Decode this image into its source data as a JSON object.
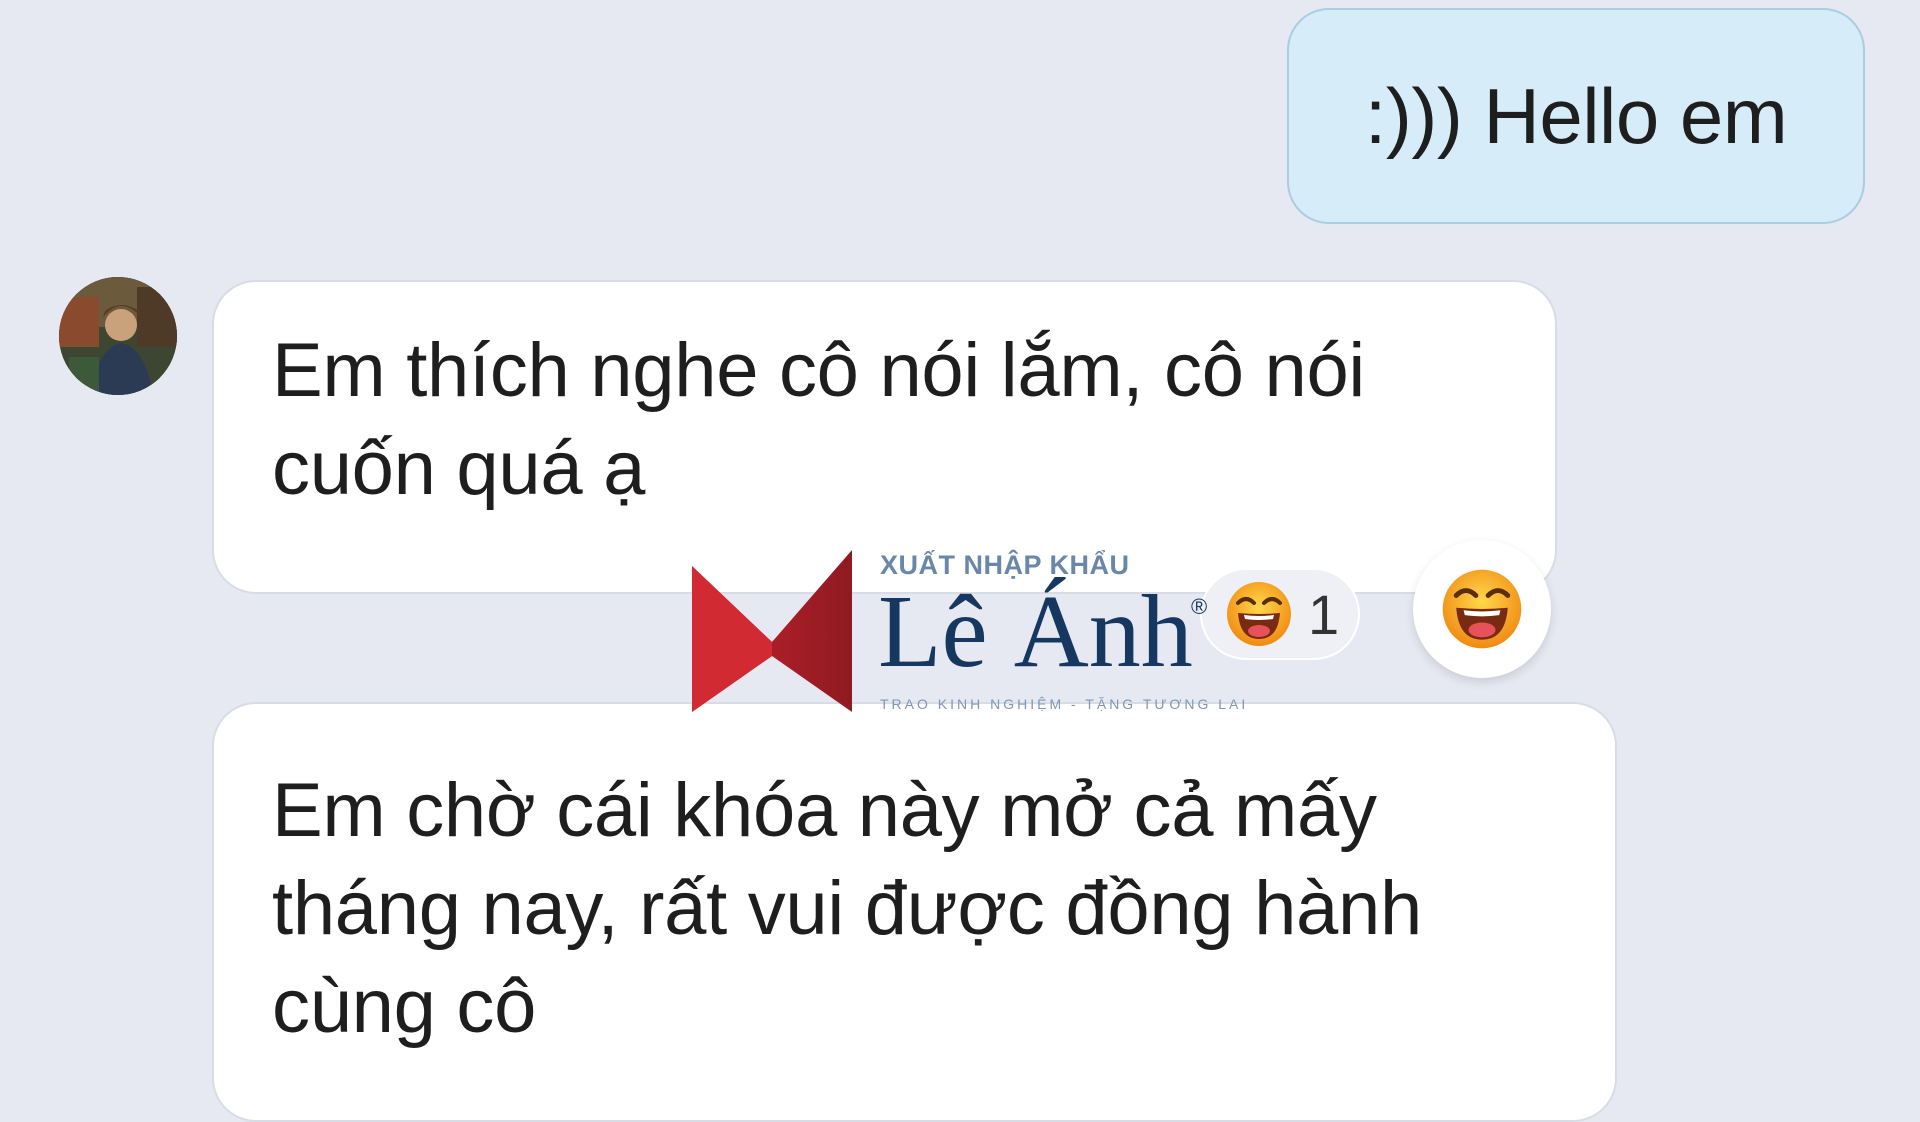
{
  "messages": {
    "outgoing": {
      "text": ":))) Hello em"
    },
    "incoming": [
      {
        "lines": [
          "Em thích nghe cô nói lắm, cô nói",
          "cuốn quá ạ"
        ]
      },
      {
        "lines": [
          "Em chờ cái khóa này mở cả mấy",
          "tháng nay, rất vui được đồng hành",
          "cùng cô"
        ]
      }
    ]
  },
  "reaction": {
    "icon": "laughing-emoji-icon",
    "count": "1"
  },
  "watermark": {
    "top_line": "XUẤT NHẬP KHẨU",
    "name": "Lê Ánh",
    "registered": "®",
    "tagline": "TRAO KINH NGHIỆM - TẶNG TƯƠNG LAI"
  },
  "colors": {
    "background": "#e6e9f2",
    "outgoing_bubble": "#d6ecf9",
    "incoming_bubble": "#ffffff",
    "logo_red": "#c8232c",
    "logo_navy": "#16375f"
  }
}
